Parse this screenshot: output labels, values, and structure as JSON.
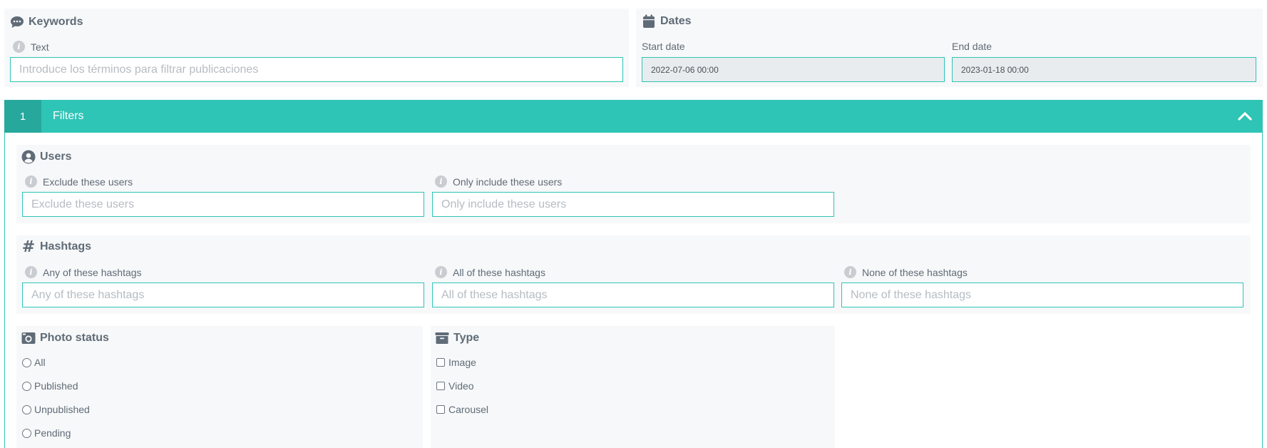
{
  "keywords": {
    "title": "Keywords",
    "icon": "comment-icon",
    "text_label": "Text",
    "text_placeholder": "Introduce los términos para filtrar publicaciones"
  },
  "dates": {
    "title": "Dates",
    "icon": "calendar-icon",
    "start_label": "Start date",
    "start_value": "2022-07-06 00:00",
    "end_label": "End date",
    "end_value": "2023-01-18 00:00"
  },
  "filters_bar": {
    "number": "1",
    "title": "Filters",
    "toggle_icon": "chevron-up-icon"
  },
  "users": {
    "title": "Users",
    "icon": "user-circle-icon",
    "exclude_label": "Exclude these users",
    "exclude_placeholder": "Exclude these users",
    "include_label": "Only include these users",
    "include_placeholder": "Only include these users"
  },
  "hashtags": {
    "title": "Hashtags",
    "icon": "hash-icon",
    "any_label": "Any of these hashtags",
    "any_placeholder": "Any of these hashtags",
    "all_label": "All of these hashtags",
    "all_placeholder": "All of these hashtags",
    "none_label": "None of these hashtags",
    "none_placeholder": "None of these hashtags"
  },
  "photo_status": {
    "title": "Photo status",
    "icon": "camera-icon",
    "options": [
      "All",
      "Published",
      "Unpublished",
      "Pending"
    ]
  },
  "type": {
    "title": "Type",
    "icon": "archive-icon",
    "options": [
      "Image",
      "Video",
      "Carousel"
    ]
  },
  "colors": {
    "accent": "#2ec4b6",
    "accent_dark": "#26a89c",
    "panel_bg": "#f7f8f9",
    "text": "#5f6b77"
  }
}
